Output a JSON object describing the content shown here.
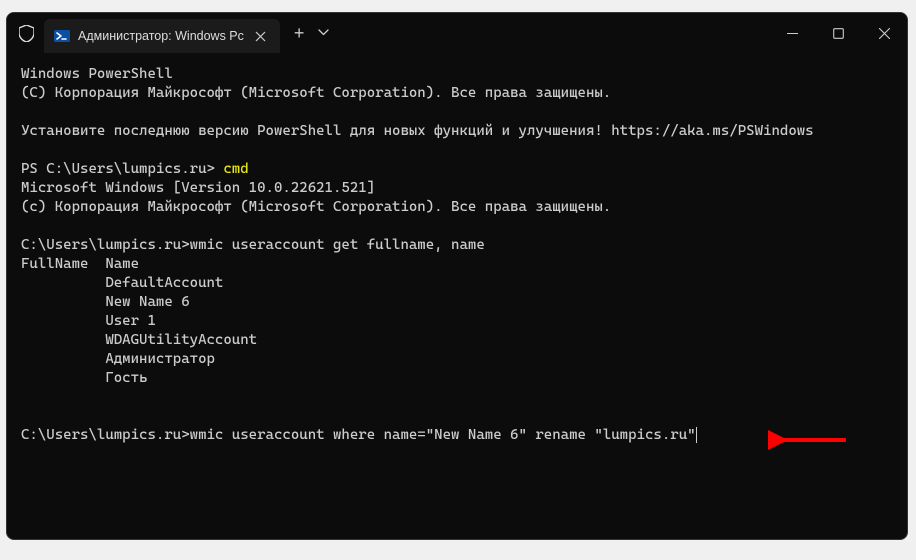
{
  "tab": {
    "title": "Администратор: Windows Pc"
  },
  "term": {
    "l1": "Windows PowerShell",
    "l2": "(C) Корпорация Майкрософт (Microsoft Corporation). Все права защищены.",
    "blank1": "",
    "l3": "Установите последнюю версию PowerShell для новых функций и улучшения! https://aka.ms/PSWindows",
    "blank2": "",
    "l4a": "PS C:\\Users\\lumpics.ru> ",
    "l4b": "cmd",
    "l5": "Microsoft Windows [Version 10.0.22621.521]",
    "l6": "(c) Корпорация Майкрософт (Microsoft Corporation). Все права защищены.",
    "blank3": "",
    "l7": "C:\\Users\\lumpics.ru>wmic useraccount get fullname, name",
    "l8": "FullName  Name",
    "l9": "          DefaultAccount",
    "l10": "          New Name 6",
    "l11": "          User 1",
    "l12": "          WDAGUtilityAccount",
    "l13": "          Администратор",
    "l14": "          Гость",
    "blank4": "",
    "blank5": "",
    "l15": "C:\\Users\\lumpics.ru>wmic useraccount where name=\"New Name 6\" rename \"lumpics.ru\""
  }
}
